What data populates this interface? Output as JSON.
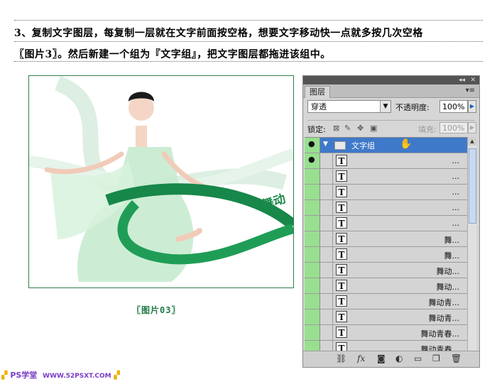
{
  "instructions": {
    "line1": "3、复制文字图层，每复制一层就在文字前面按空格，想要文字移动快一点就多按几次空格",
    "line2": "〖图片3〗。然后新建一个组为『文字组』，把文字图层都拖进该组中。"
  },
  "image": {
    "photo_text": "舞动",
    "caption": "〖图片03〗"
  },
  "panel": {
    "tab_label": "图层",
    "blend_mode": "穿透",
    "opacity_label": "不透明度:",
    "opacity_value": "100%",
    "lock_label": "锁定:",
    "fill_label": "填充:",
    "fill_value": "100%",
    "group": {
      "name": "文字组"
    },
    "text_layers": [
      "...",
      "...",
      "...",
      "...",
      "...",
      "舞...",
      "舞...",
      "舞动...",
      "舞动...",
      "舞动青...",
      "舞动青...",
      "舞动青春...",
      "舞动青春..."
    ],
    "accent_selected": "#3f79c9",
    "accent_visibility": "#98e08f"
  },
  "watermark": {
    "brand": "PS学堂",
    "url": "WWW.52PSXT.COM"
  }
}
